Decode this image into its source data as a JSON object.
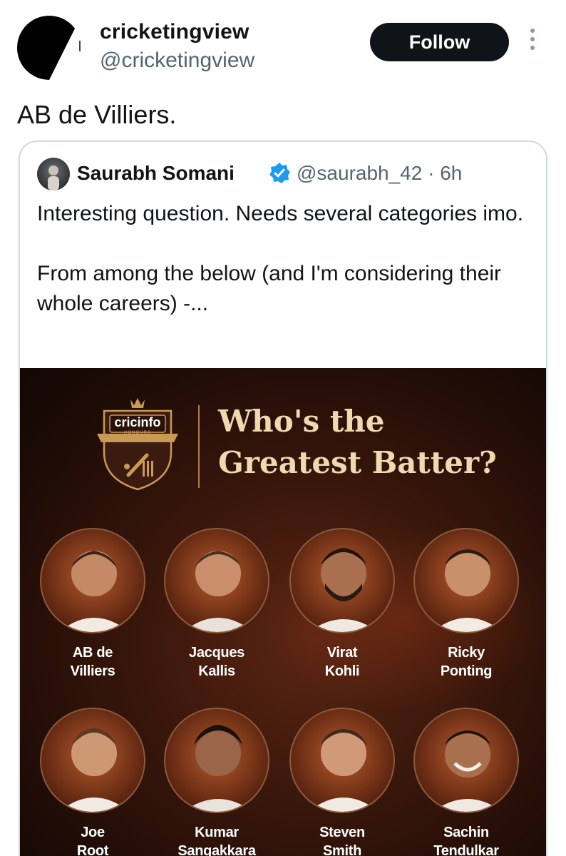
{
  "header": {
    "name": "cricketingview",
    "handle": "@cricketingview",
    "follow_label": "Follow",
    "more_icon": "more-vertical-icon"
  },
  "tweet": {
    "text": "AB de Villiers."
  },
  "quoted": {
    "name": "Saurabh Somani",
    "handle": "@saurabh_42 · 6h",
    "verified_color": "#1d9bf0",
    "paragraphs": [
      "Interesting question. Needs several categories imo.",
      "From among the below (and I'm considering their whole careers) -..."
    ]
  },
  "poster": {
    "logo_text": "cricinfo",
    "logo_sub": "HONOURS",
    "title_line1": "Who's the",
    "title_line2": "Greatest Batter?",
    "players": [
      {
        "name": "AB de\nVilliers"
      },
      {
        "name": "Jacques\nKallis"
      },
      {
        "name": "Virat\nKohli"
      },
      {
        "name": "Ricky\nPonting"
      },
      {
        "name": "Joe\nRoot"
      },
      {
        "name": "Kumar\nSangakkara"
      },
      {
        "name": "Steven\nSmith"
      },
      {
        "name": "Sachin\nTendulkar"
      }
    ]
  }
}
